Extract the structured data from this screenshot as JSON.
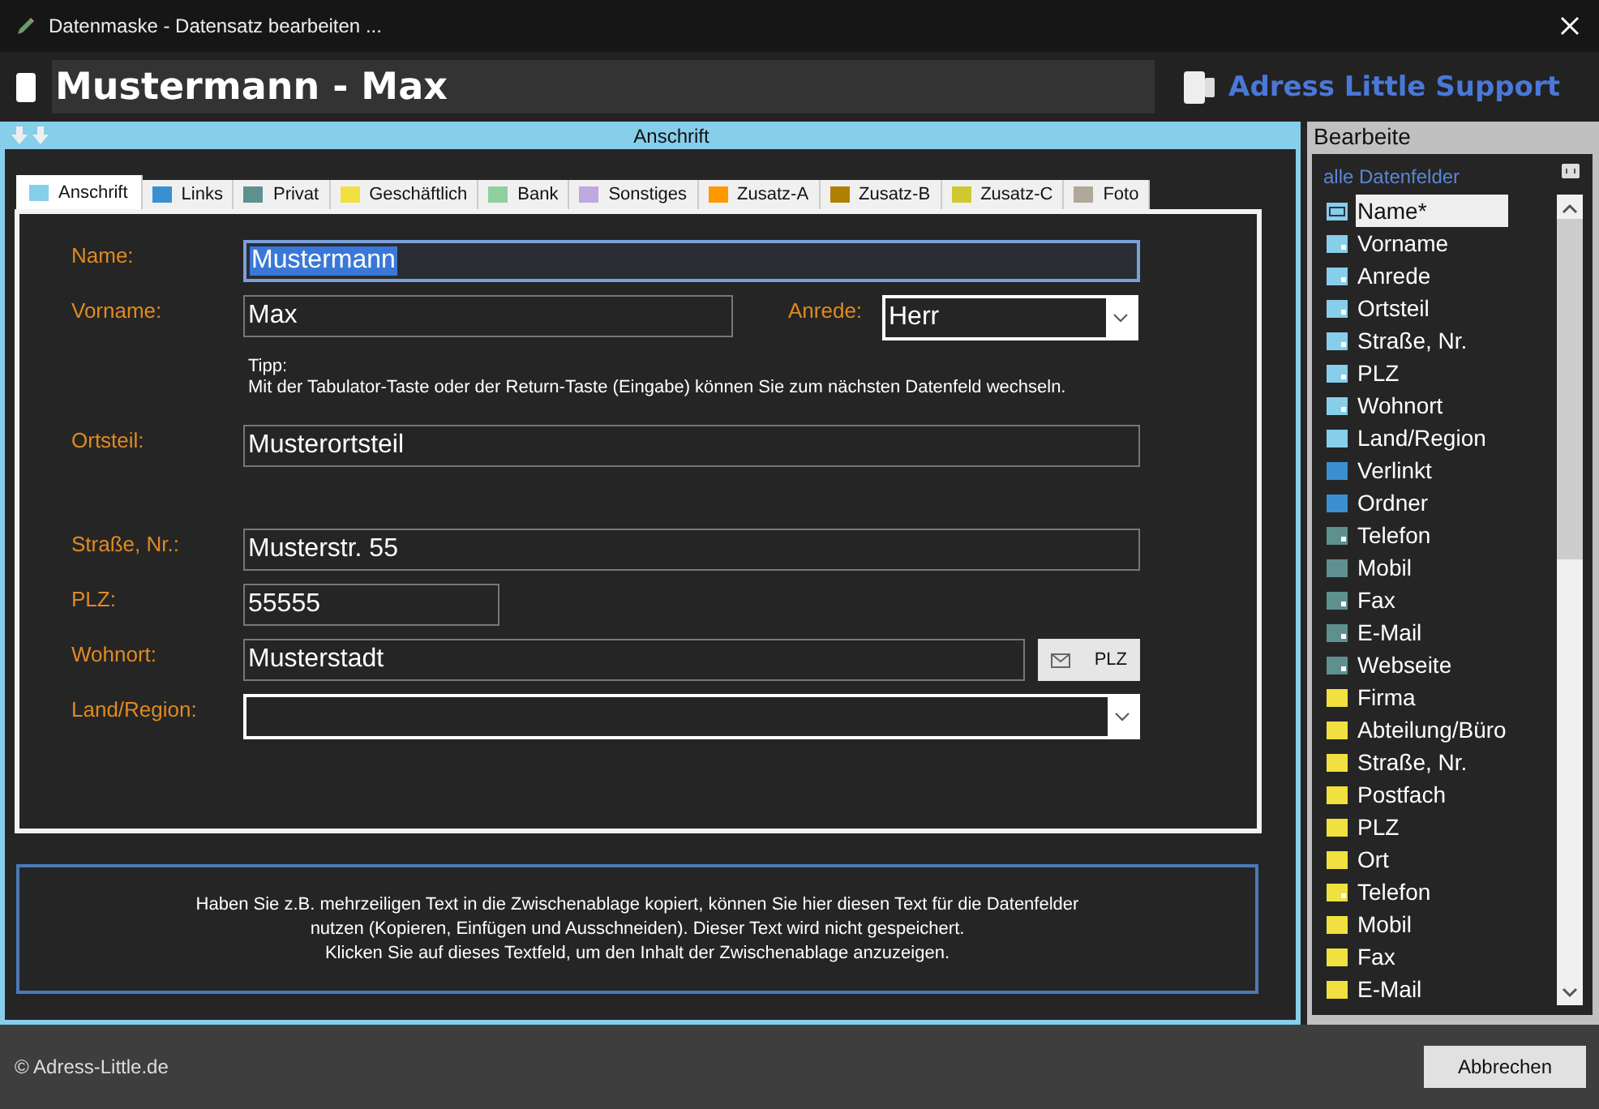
{
  "window": {
    "title": "Datenmaske - Datensatz bearbeiten ..."
  },
  "header": {
    "record_title": "Mustermann - Max",
    "brand": "Adress Little Support"
  },
  "panel": {
    "title": "Anschrift"
  },
  "tabs": [
    {
      "label": "Anschrift",
      "color": "#87ceeb",
      "selected": true
    },
    {
      "label": "Links",
      "color": "#3a8fd0",
      "selected": false
    },
    {
      "label": "Privat",
      "color": "#5f9090",
      "selected": false
    },
    {
      "label": "Geschäftlich",
      "color": "#f0e040",
      "selected": false
    },
    {
      "label": "Bank",
      "color": "#90d0a0",
      "selected": false
    },
    {
      "label": "Sonstiges",
      "color": "#c0a8e0",
      "selected": false
    },
    {
      "label": "Zusatz-A",
      "color": "#ff9900",
      "selected": false
    },
    {
      "label": "Zusatz-B",
      "color": "#b08000",
      "selected": false
    },
    {
      "label": "Zusatz-C",
      "color": "#d0c830",
      "selected": false
    },
    {
      "label": "Foto",
      "color": "#b0a898",
      "selected": false
    }
  ],
  "form": {
    "rows": [
      {
        "fields": [
          {
            "label": "Name:",
            "kind": "text",
            "value": "Mustermann",
            "focused": true
          }
        ]
      },
      {
        "fields": [
          {
            "label": "Vorname:",
            "kind": "text",
            "value": "Max",
            "focused": false
          },
          {
            "label": "Anrede:",
            "kind": "select",
            "value": "Herr",
            "focused": false
          }
        ]
      },
      {
        "tip": [
          "Tipp:",
          "Mit der Tabulator-Taste oder der Return-Taste (Eingabe) können Sie zum nächsten Datenfeld wechseln."
        ]
      },
      {
        "fields": [
          {
            "label": "Ortsteil:",
            "kind": "text",
            "value": "Musterortsteil",
            "focused": false
          }
        ]
      },
      {
        "fields": [
          {
            "label": "Straße, Nr.:",
            "kind": "text",
            "value": "Musterstr. 55",
            "focused": false
          }
        ]
      },
      {
        "fields": [
          {
            "label": "PLZ:",
            "kind": "text",
            "value": "55555",
            "focused": false
          }
        ]
      },
      {
        "fields": [
          {
            "label": "Wohnort:",
            "kind": "text",
            "value": "Musterstadt",
            "focused": false,
            "button": "PLZ"
          }
        ]
      },
      {
        "fields": [
          {
            "label": "Land/Region:",
            "kind": "select",
            "focused": false
          }
        ]
      }
    ]
  },
  "clipboard_note": [
    "Haben Sie z.B. mehrzeiligen Text in die Zwischenablage kopiert, können Sie hier diesen Text für die Datenfelder",
    "nutzen (Kopieren, Einfügen und Ausschneiden). Dieser Text wird nicht gespeichert.",
    "Klicken Sie auf dieses Textfeld, um den Inhalt der Zwischenablage anzuzeigen."
  ],
  "sidebar": {
    "title": "Bearbeite",
    "filter": "alle Datenfelder",
    "items": [
      {
        "label": "Name*",
        "color": "#87ceeb",
        "has_value": true,
        "selected": true
      },
      {
        "label": "Vorname",
        "color": "#87ceeb",
        "has_value": true,
        "selected": false
      },
      {
        "label": "Anrede",
        "color": "#87ceeb",
        "has_value": true,
        "selected": false
      },
      {
        "label": "Ortsteil",
        "color": "#87ceeb",
        "has_value": true,
        "selected": false
      },
      {
        "label": "Straße, Nr.",
        "color": "#87ceeb",
        "has_value": true,
        "selected": false
      },
      {
        "label": "PLZ",
        "color": "#87ceeb",
        "has_value": true,
        "selected": false
      },
      {
        "label": "Wohnort",
        "color": "#87ceeb",
        "has_value": true,
        "selected": false
      },
      {
        "label": "Land/Region",
        "color": "#87ceeb",
        "has_value": false,
        "selected": false
      },
      {
        "label": "Verlinkt",
        "color": "#3a8fd0",
        "has_value": false,
        "selected": false
      },
      {
        "label": "Ordner",
        "color": "#3a8fd0",
        "has_value": false,
        "selected": false
      },
      {
        "label": "Telefon",
        "color": "#5f9090",
        "has_value": true,
        "selected": false
      },
      {
        "label": "Mobil",
        "color": "#5f9090",
        "has_value": false,
        "selected": false
      },
      {
        "label": "Fax",
        "color": "#5f9090",
        "has_value": true,
        "selected": false
      },
      {
        "label": "E-Mail",
        "color": "#5f9090",
        "has_value": true,
        "selected": false
      },
      {
        "label": "Webseite",
        "color": "#5f9090",
        "has_value": true,
        "selected": false
      },
      {
        "label": "Firma",
        "color": "#f0e040",
        "has_value": false,
        "selected": false
      },
      {
        "label": "Abteilung/Büro",
        "color": "#f0e040",
        "has_value": false,
        "selected": false
      },
      {
        "label": "Straße, Nr.",
        "color": "#f0e040",
        "has_value": false,
        "selected": false
      },
      {
        "label": "Postfach",
        "color": "#f0e040",
        "has_value": false,
        "selected": false
      },
      {
        "label": "PLZ",
        "color": "#f0e040",
        "has_value": false,
        "selected": false
      },
      {
        "label": "Ort",
        "color": "#f0e040",
        "has_value": false,
        "selected": false
      },
      {
        "label": "Telefon",
        "color": "#f0e040",
        "has_value": true,
        "selected": false
      },
      {
        "label": "Mobil",
        "color": "#f0e040",
        "has_value": false,
        "selected": false
      },
      {
        "label": "Fax",
        "color": "#f0e040",
        "has_value": false,
        "selected": false
      },
      {
        "label": "E-Mail",
        "color": "#f0e040",
        "has_value": false,
        "selected": false
      }
    ]
  },
  "footer": {
    "copyright": "© Adress-Little.de",
    "buttons": [
      "Abbrechen"
    ]
  }
}
